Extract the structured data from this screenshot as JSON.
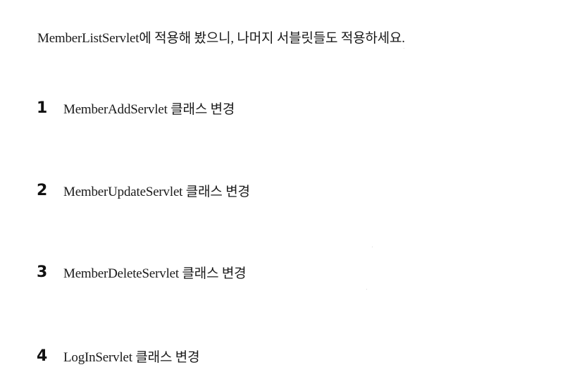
{
  "intro_text": "MemberListServlet에 적용해 봤으니, 나머지 서블릿들도 적용하세요.",
  "steps": [
    {
      "number": "1",
      "label": "MemberAddServlet 클래스 변경"
    },
    {
      "number": "2",
      "label": "MemberUpdateServlet 클래스 변경"
    },
    {
      "number": "3",
      "label": "MemberDeleteServlet 클래스 변경"
    },
    {
      "number": "4",
      "label": "LogInServlet 클래스 변경"
    }
  ]
}
